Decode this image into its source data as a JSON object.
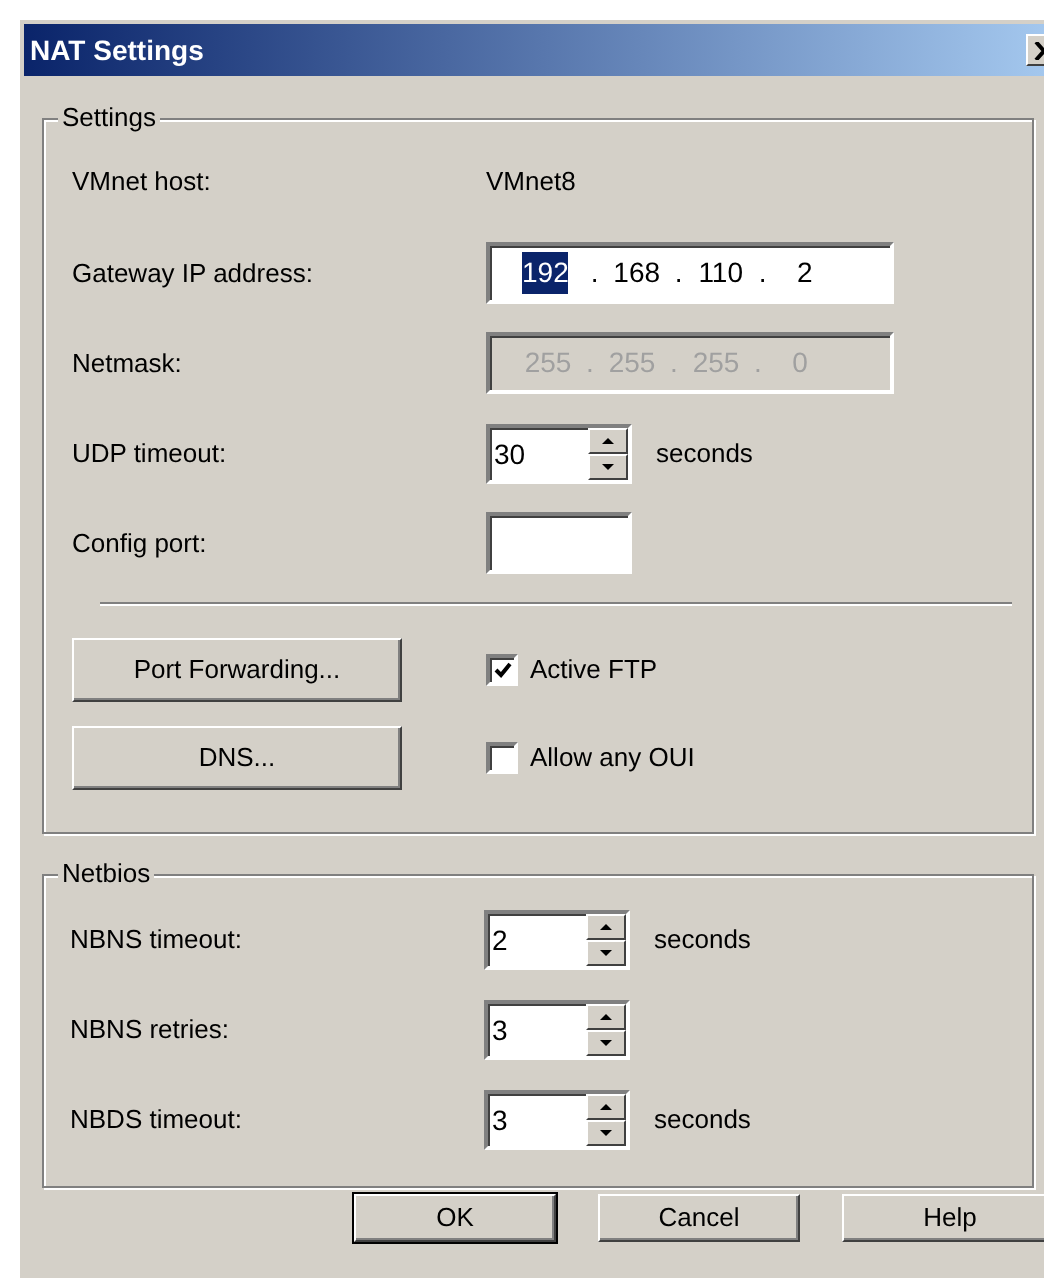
{
  "window": {
    "title": "NAT Settings"
  },
  "settings": {
    "title": "Settings",
    "host": {
      "label": "VMnet host:",
      "value": "VMnet8"
    },
    "ip_fields": [
      {
        "label": "Gateway IP address:",
        "disabled": false,
        "separator": ".",
        "octets": [
          {
            "text": "192",
            "selected": true
          },
          {
            "text": "168",
            "selected": false
          },
          {
            "text": "110",
            "selected": false
          },
          {
            "text": "2",
            "selected": false
          }
        ]
      },
      {
        "label": "Netmask:",
        "disabled": true,
        "separator": ".",
        "octets": [
          {
            "text": "255",
            "selected": false
          },
          {
            "text": "255",
            "selected": false
          },
          {
            "text": "255",
            "selected": false
          },
          {
            "text": "0",
            "selected": false
          }
        ]
      }
    ],
    "udp": {
      "label": "UDP timeout:",
      "value": "30",
      "unit": "seconds"
    },
    "config_port": {
      "label": "Config port:"
    },
    "actions": [
      {
        "button": "Port Forwarding...",
        "checkbox": "Active FTP",
        "checked": true
      },
      {
        "button": "DNS...",
        "checkbox": "Allow any OUI",
        "checked": false
      }
    ]
  },
  "netbios": {
    "title": "Netbios",
    "rows": [
      {
        "label": "NBNS timeout:",
        "value": "2",
        "unit": "seconds"
      },
      {
        "label": "NBNS retries:",
        "value": "3"
      },
      {
        "label": "NBDS timeout:",
        "value": "3",
        "unit": "seconds"
      }
    ]
  },
  "buttons": [
    {
      "label": "OK",
      "default": true
    },
    {
      "label": "Cancel",
      "default": false
    },
    {
      "label": "Help",
      "default": false
    }
  ]
}
